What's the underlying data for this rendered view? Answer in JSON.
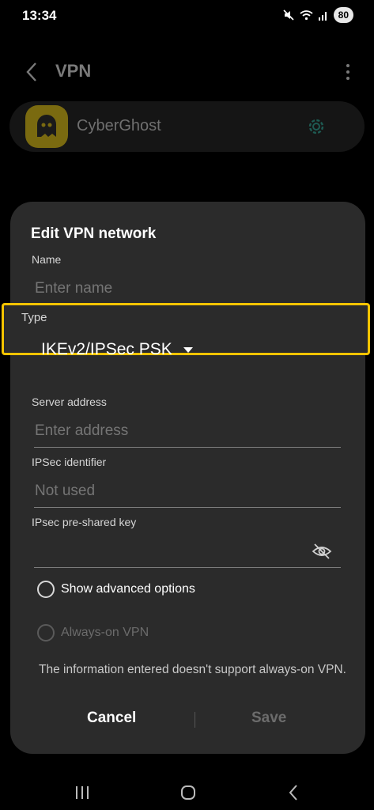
{
  "status_bar": {
    "time": "13:34",
    "battery": "80",
    "icons": [
      "mute-icon",
      "wifi-icon",
      "signal-icon",
      "battery-icon"
    ]
  },
  "background": {
    "title": "VPN",
    "vpn_profile_name": "CyberGhost"
  },
  "dialog": {
    "title": "Edit VPN network",
    "name_label": "Name",
    "name_placeholder": "Enter name",
    "type_label": "Type",
    "type_value": "IKEv2/IPSec PSK",
    "server_label": "Server address",
    "server_placeholder": "Enter address",
    "ipsec_id_label": "IPSec identifier",
    "ipsec_id_placeholder": "Not used",
    "psk_label": "IPsec pre-shared key",
    "psk_value": "",
    "advanced_label": "Show advanced options",
    "always_on_label": "Always-on VPN",
    "info_text": "The information entered doesn't support always-on VPN.",
    "cancel_label": "Cancel",
    "save_label": "Save"
  },
  "colors": {
    "highlight": "#f5c400",
    "dialog_bg": "#2b2b2b",
    "logo": "#f5c400"
  }
}
